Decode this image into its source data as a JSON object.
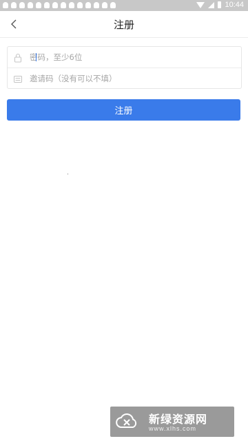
{
  "status_bar": {
    "notification_icons": [
      "qq-icon",
      "qq-icon",
      "qq-icon",
      "qq-icon",
      "qq-icon",
      "qq-icon",
      "qq-icon",
      "qq-icon",
      "qq-icon",
      "qq-icon",
      "qq-icon",
      "qq-icon",
      "qq-icon",
      "qq-icon"
    ],
    "time": "10:44"
  },
  "header": {
    "back_icon": "chevron-left-icon",
    "title": "注册"
  },
  "form": {
    "password": {
      "icon": "lock-icon",
      "placeholder": "密码，至少6位",
      "value": ""
    },
    "invite_code": {
      "icon": "invite-code-icon",
      "placeholder": "邀请码（没有可以不填）",
      "value": ""
    }
  },
  "register_button": {
    "label": "注册",
    "color": "#3a7bea"
  },
  "watermark": {
    "title": "新绿资源网",
    "url": "www.xlhs.com"
  }
}
